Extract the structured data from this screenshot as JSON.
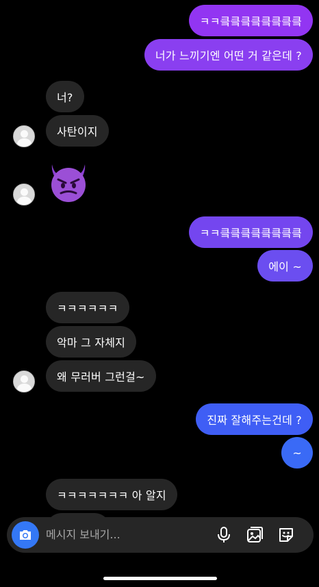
{
  "messages": [
    {
      "side": "out",
      "text": "ㅋㅋ킄킄킄킄킄킄킄킄",
      "color": "#9235f2"
    },
    {
      "side": "out",
      "text": "너가 느끼기엔 어떤 거 같은데 ?",
      "color": "#8a3ff0"
    },
    {
      "side": "in",
      "text": "너?"
    },
    {
      "side": "in",
      "text": "사탄이지"
    },
    {
      "side": "in",
      "emoji": "smiling-imp-emoji"
    },
    {
      "side": "out",
      "text": "ㅋㅋ킄킄킄킄킄킄킄킄",
      "color": "#7446ef"
    },
    {
      "side": "out",
      "text": "에이 ~",
      "color": "#6b4ef0"
    },
    {
      "side": "in",
      "text": "ㅋㅋㅋㅋㅋㅋ"
    },
    {
      "side": "in",
      "text": "악마 그 자체지"
    },
    {
      "side": "in",
      "text": "왜 무러버 그런걸~"
    },
    {
      "side": "out",
      "text": "진짜 잘해주는건데 ?",
      "color": "#3f5ef5"
    },
    {
      "side": "out",
      "text": "~",
      "color": "#3a6af6"
    },
    {
      "side": "in",
      "text": "ㅋㅋㅋㅋㅋㅋㅋ 아 알지"
    }
  ],
  "composer": {
    "placeholder": "메시지 보내기...",
    "accent": "#3478f6",
    "icons": [
      "camera-icon",
      "microphone-icon",
      "gallery-icon",
      "sticker-icon"
    ]
  }
}
